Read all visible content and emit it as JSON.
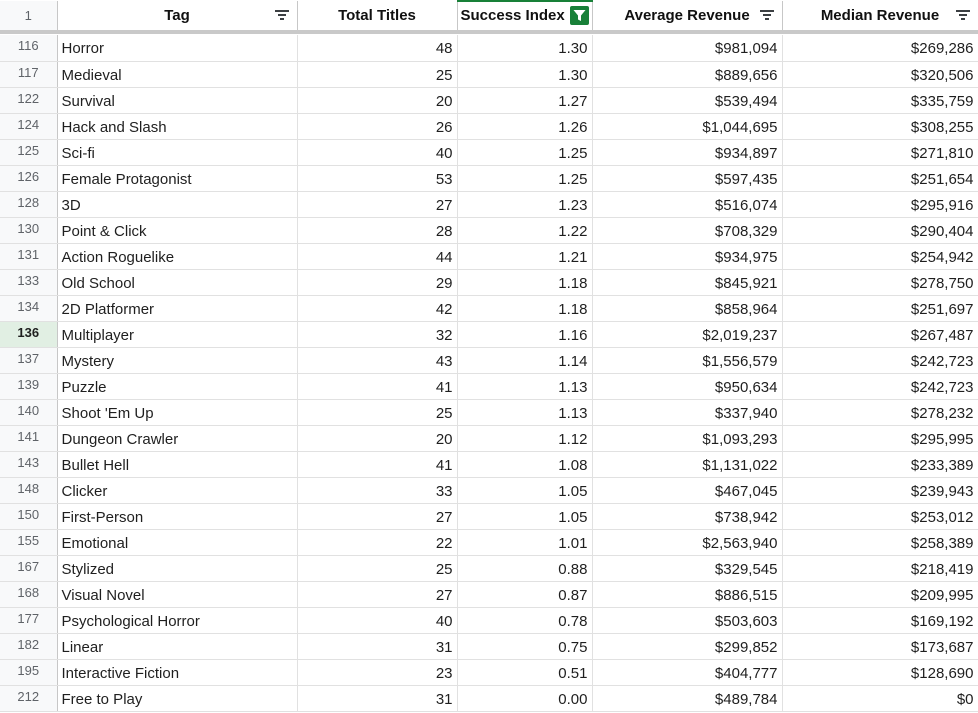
{
  "header": {
    "row_number": "1",
    "columns": [
      {
        "key": "tag",
        "label": "Tag",
        "filter": "filter-icon"
      },
      {
        "key": "total",
        "label": "Total Titles",
        "filter": "none"
      },
      {
        "key": "success",
        "label": "Success Index",
        "filter": "active-filter-icon"
      },
      {
        "key": "avg",
        "label": "Average Revenue",
        "filter": "filter-icon"
      },
      {
        "key": "med",
        "label": "Median Revenue",
        "filter": "filter-icon"
      }
    ],
    "colors": {
      "active_filter": "#188038",
      "row_header_bg": "#f8f9fa",
      "active_row_bg": "#e1efe3"
    }
  },
  "active_row": "136",
  "rows": [
    {
      "n": "116",
      "tag": "Horror",
      "total": "48",
      "success": "1.30",
      "avg": "$981,094",
      "med": "$269,286"
    },
    {
      "n": "117",
      "tag": "Medieval",
      "total": "25",
      "success": "1.30",
      "avg": "$889,656",
      "med": "$320,506"
    },
    {
      "n": "122",
      "tag": "Survival",
      "total": "20",
      "success": "1.27",
      "avg": "$539,494",
      "med": "$335,759"
    },
    {
      "n": "124",
      "tag": "Hack and Slash",
      "total": "26",
      "success": "1.26",
      "avg": "$1,044,695",
      "med": "$308,255"
    },
    {
      "n": "125",
      "tag": "Sci-fi",
      "total": "40",
      "success": "1.25",
      "avg": "$934,897",
      "med": "$271,810"
    },
    {
      "n": "126",
      "tag": "Female Protagonist",
      "total": "53",
      "success": "1.25",
      "avg": "$597,435",
      "med": "$251,654"
    },
    {
      "n": "128",
      "tag": "3D",
      "total": "27",
      "success": "1.23",
      "avg": "$516,074",
      "med": "$295,916"
    },
    {
      "n": "130",
      "tag": "Point & Click",
      "total": "28",
      "success": "1.22",
      "avg": "$708,329",
      "med": "$290,404"
    },
    {
      "n": "131",
      "tag": "Action Roguelike",
      "total": "44",
      "success": "1.21",
      "avg": "$934,975",
      "med": "$254,942"
    },
    {
      "n": "133",
      "tag": "Old School",
      "total": "29",
      "success": "1.18",
      "avg": "$845,921",
      "med": "$278,750"
    },
    {
      "n": "134",
      "tag": "2D Platformer",
      "total": "42",
      "success": "1.18",
      "avg": "$858,964",
      "med": "$251,697"
    },
    {
      "n": "136",
      "tag": "Multiplayer",
      "total": "32",
      "success": "1.16",
      "avg": "$2,019,237",
      "med": "$267,487"
    },
    {
      "n": "137",
      "tag": "Mystery",
      "total": "43",
      "success": "1.14",
      "avg": "$1,556,579",
      "med": "$242,723"
    },
    {
      "n": "139",
      "tag": "Puzzle",
      "total": "41",
      "success": "1.13",
      "avg": "$950,634",
      "med": "$242,723"
    },
    {
      "n": "140",
      "tag": "Shoot 'Em Up",
      "total": "25",
      "success": "1.13",
      "avg": "$337,940",
      "med": "$278,232"
    },
    {
      "n": "141",
      "tag": "Dungeon Crawler",
      "total": "20",
      "success": "1.12",
      "avg": "$1,093,293",
      "med": "$295,995"
    },
    {
      "n": "143",
      "tag": "Bullet Hell",
      "total": "41",
      "success": "1.08",
      "avg": "$1,131,022",
      "med": "$233,389"
    },
    {
      "n": "148",
      "tag": "Clicker",
      "total": "33",
      "success": "1.05",
      "avg": "$467,045",
      "med": "$239,943"
    },
    {
      "n": "150",
      "tag": "First-Person",
      "total": "27",
      "success": "1.05",
      "avg": "$738,942",
      "med": "$253,012"
    },
    {
      "n": "155",
      "tag": "Emotional",
      "total": "22",
      "success": "1.01",
      "avg": "$2,563,940",
      "med": "$258,389"
    },
    {
      "n": "167",
      "tag": "Stylized",
      "total": "25",
      "success": "0.88",
      "avg": "$329,545",
      "med": "$218,419"
    },
    {
      "n": "168",
      "tag": "Visual Novel",
      "total": "27",
      "success": "0.87",
      "avg": "$886,515",
      "med": "$209,995"
    },
    {
      "n": "177",
      "tag": "Psychological Horror",
      "total": "40",
      "success": "0.78",
      "avg": "$503,603",
      "med": "$169,192"
    },
    {
      "n": "182",
      "tag": "Linear",
      "total": "31",
      "success": "0.75",
      "avg": "$299,852",
      "med": "$173,687"
    },
    {
      "n": "195",
      "tag": "Interactive Fiction",
      "total": "23",
      "success": "0.51",
      "avg": "$404,777",
      "med": "$128,690"
    },
    {
      "n": "212",
      "tag": "Free to Play",
      "total": "31",
      "success": "0.00",
      "avg": "$489,784",
      "med": "$0"
    }
  ]
}
